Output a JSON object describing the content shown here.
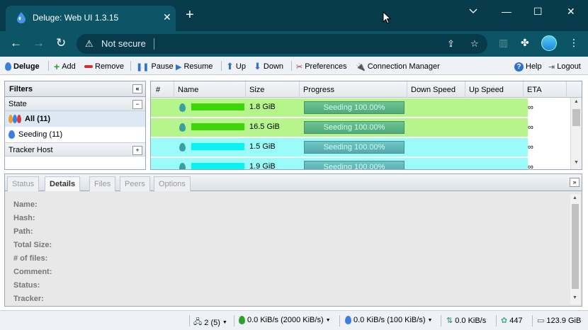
{
  "browser": {
    "tab_title": "Deluge: Web UI 1.3.15",
    "tab_close": "✕",
    "new_tab": "+",
    "address_security": "Not secure",
    "window_controls": {
      "minimize": "—",
      "maximize": "☐",
      "close": "✕"
    }
  },
  "toolbar": {
    "app_name": "Deluge",
    "add": "Add",
    "remove": "Remove",
    "pause": "Pause",
    "resume": "Resume",
    "up": "Up",
    "down": "Down",
    "preferences": "Preferences",
    "connection_manager": "Connection Manager",
    "help": "Help",
    "logout": "Logout"
  },
  "sidebar": {
    "title": "Filters",
    "collapse": "«",
    "state_section": "State",
    "state_toggle": "−",
    "items": [
      {
        "label": "All (11)",
        "selected": true
      },
      {
        "label": "Seeding (11)",
        "selected": false
      }
    ],
    "tracker_section": "Tracker Host",
    "tracker_toggle": "+"
  },
  "grid": {
    "columns": [
      "#",
      "Name",
      "Size",
      "Progress",
      "Down Speed",
      "Up Speed",
      "ETA"
    ],
    "rows": [
      {
        "size": "1.8 GiB",
        "progress": "Seeding 100.00%",
        "progress_value": 100,
        "eta": "∞",
        "color": "#b6f58c"
      },
      {
        "size": "16.5 GiB",
        "progress": "Seeding 100.00%",
        "progress_value": 100,
        "eta": "∞",
        "color": "#b6f58c"
      },
      {
        "size": "1.5 GiB",
        "progress": "Seeding 100.00%",
        "progress_value": 100,
        "eta": "∞",
        "color": "#9afcf8"
      },
      {
        "size": "1.9 GiB",
        "progress": "Seeding 100.00%",
        "progress_value": 100,
        "eta": "∞",
        "color": "#9afcf8"
      }
    ]
  },
  "details": {
    "tabs": [
      "Status",
      "Details",
      "Files",
      "Peers",
      "Options"
    ],
    "active_tab": "Details",
    "collapse": "»",
    "labels": [
      "Name:",
      "Hash:",
      "Path:",
      "Total Size:",
      "# of files:",
      "Comment:",
      "Status:",
      "Tracker:"
    ]
  },
  "statusbar": {
    "connections": "2 (5)",
    "download": "0.0 KiB/s (2000 KiB/s)",
    "upload": "0.0 KiB/s (100 KiB/s)",
    "traffic": "0.0 KiB/s",
    "dht_nodes": "447",
    "free_space": "123.9 GiB"
  }
}
